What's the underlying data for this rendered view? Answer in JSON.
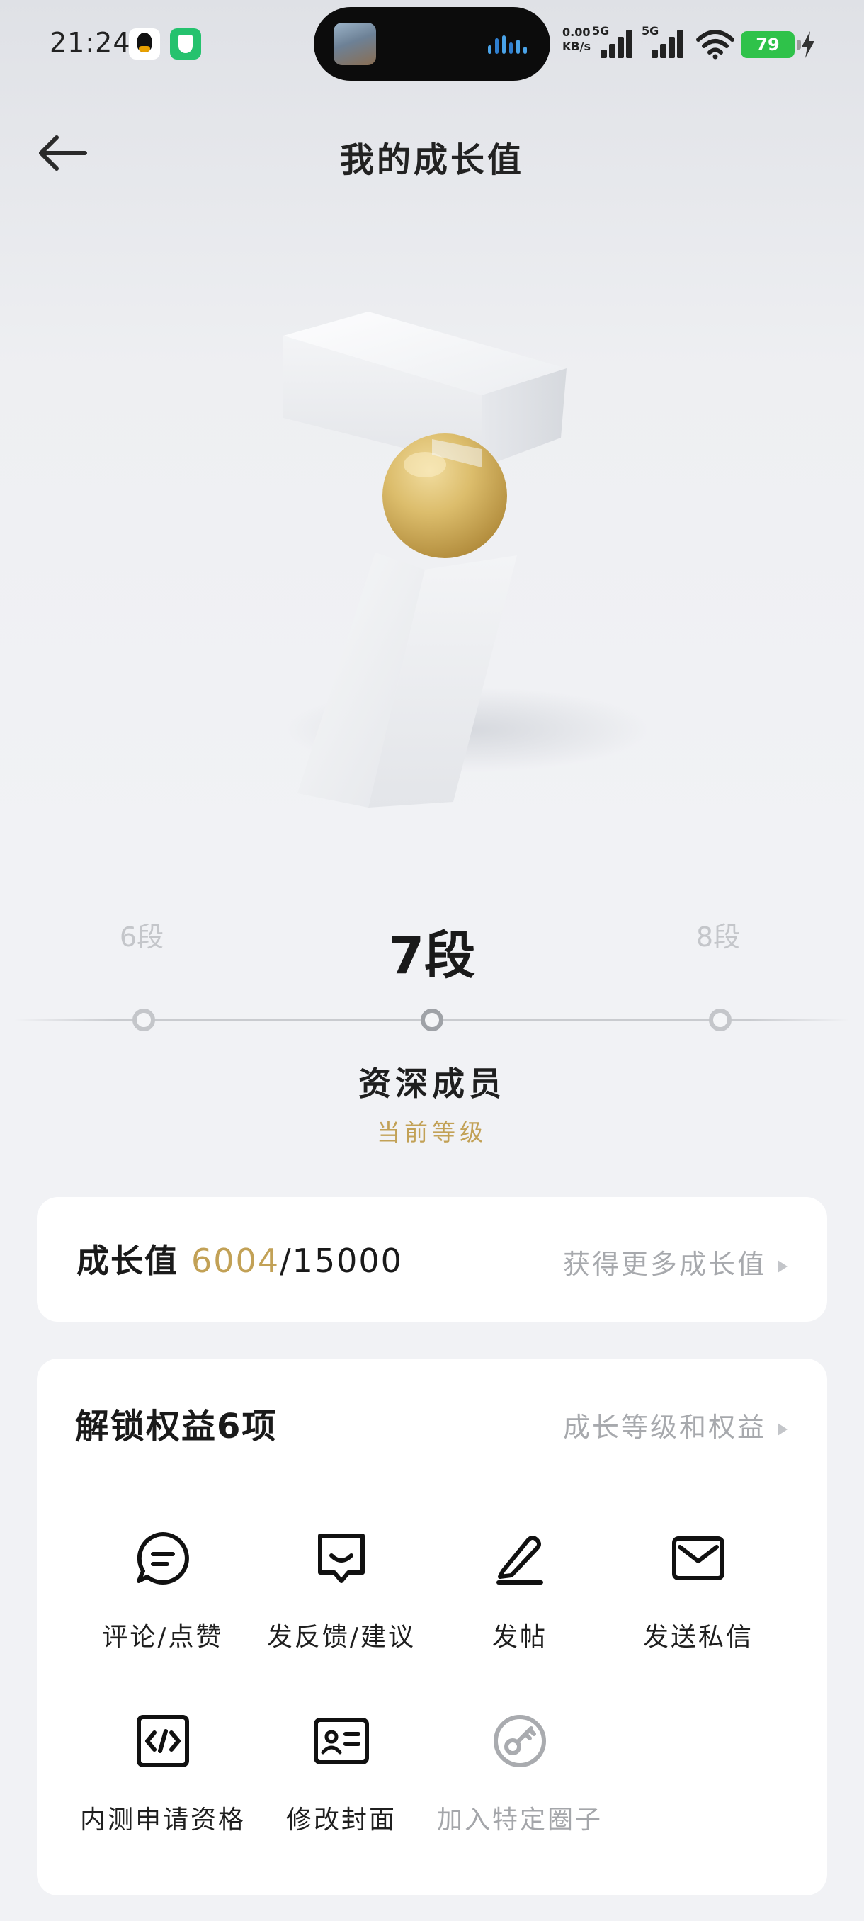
{
  "status_bar": {
    "time": "21:24",
    "network_speed": "0.00\nKB/s",
    "net_value": "0.00",
    "net_unit": "KB/s",
    "sim1": "5G",
    "sim2": "5G",
    "battery": "79"
  },
  "header": {
    "title": "我的成长值",
    "back_icon": "arrow-left-icon"
  },
  "levels": {
    "prev": "6段",
    "current": "7段",
    "next": "8段",
    "level_name": "资深成员",
    "level_caption": "当前等级"
  },
  "growth": {
    "label": "成长值 ",
    "current": "6004",
    "total": "/15000",
    "link": "获得更多成长值"
  },
  "perks": {
    "title": "解锁权益6项",
    "link": "成长等级和权益",
    "items": [
      {
        "label": "评论/点赞",
        "icon": "comment-icon",
        "enabled": true
      },
      {
        "label": "发反馈/建议",
        "icon": "feedback-icon",
        "enabled": true
      },
      {
        "label": "发帖",
        "icon": "pen-icon",
        "enabled": true
      },
      {
        "label": "发送私信",
        "icon": "mail-icon",
        "enabled": true
      },
      {
        "label": "内测申请资格",
        "icon": "code-icon",
        "enabled": true
      },
      {
        "label": "修改封面",
        "icon": "id-card-icon",
        "enabled": true
      },
      {
        "label": "加入特定圈子",
        "icon": "key-icon",
        "enabled": false
      }
    ]
  },
  "colors": {
    "accent_gold": "#c2a156",
    "battery_green": "#2fc24a",
    "muted_text": "#a7a9ad"
  }
}
